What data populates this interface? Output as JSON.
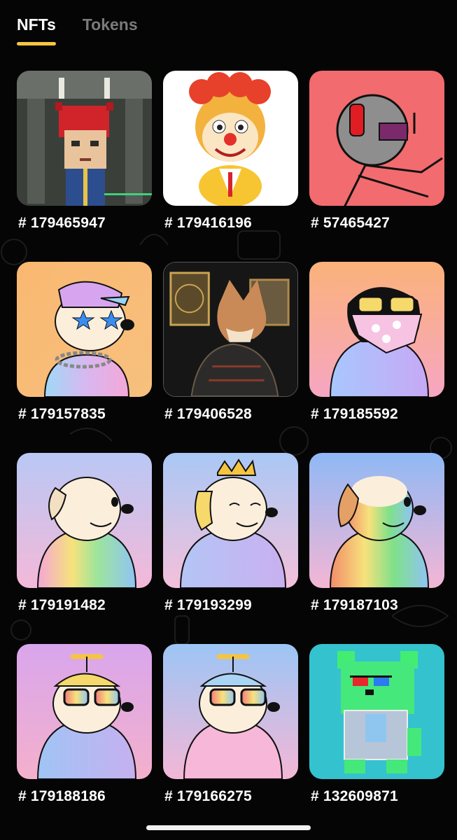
{
  "tabs": [
    {
      "label": "NFTs",
      "active": true
    },
    {
      "label": "Tokens",
      "active": false
    }
  ],
  "accent_color": "#f5c542",
  "nfts": [
    {
      "id": "# 179465947",
      "art": "pixel-devil-character"
    },
    {
      "id": "# 179416196",
      "art": "clown-mascot"
    },
    {
      "id": "# 57465427",
      "art": "stick-figure-headphones"
    },
    {
      "id": "# 179157835",
      "art": "dog-star-glasses-cap"
    },
    {
      "id": "# 179406528",
      "art": "shiba-samurai"
    },
    {
      "id": "# 179185592",
      "art": "dog-bandana-sunglasses"
    },
    {
      "id": "# 179191482",
      "art": "dog-rainbow-hoodie"
    },
    {
      "id": "# 179193299",
      "art": "dog-crown-puffer"
    },
    {
      "id": "# 179187103",
      "art": "dog-rainbow-face"
    },
    {
      "id": "# 179188186",
      "art": "dog-propeller-cap-glasses"
    },
    {
      "id": "# 179166275",
      "art": "dog-propeller-cap-pink"
    },
    {
      "id": "# 132609871",
      "art": "green-pixel-bear-3d-glasses"
    }
  ]
}
